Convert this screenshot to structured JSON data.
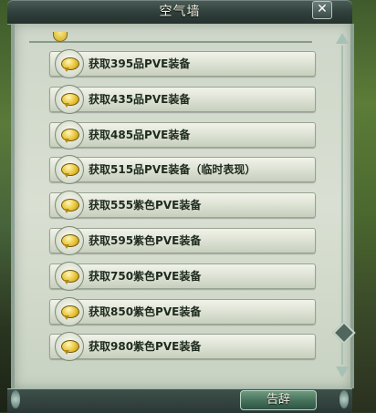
{
  "window": {
    "title": "空气墙",
    "close_glyph": "✕"
  },
  "list": {
    "items": [
      {
        "label": "获取395品PVE装备"
      },
      {
        "label": "获取435品PVE装备"
      },
      {
        "label": "获取485品PVE装备"
      },
      {
        "label": "获取515品PVE装备（临时表现）"
      },
      {
        "label": "获取555紫色PVE装备"
      },
      {
        "label": "获取595紫色PVE装备"
      },
      {
        "label": "获取750紫色PVE装备"
      },
      {
        "label": "获取850紫色PVE装备"
      },
      {
        "label": "获取980紫色PVE装备"
      }
    ]
  },
  "footer": {
    "farewell_label": "告辞"
  },
  "icons": {
    "item_icon": "speech-bubble-icon",
    "close": "close-icon"
  },
  "scrollbar": {
    "position": 0.9
  },
  "colors": {
    "panel_bg": "#d9e0d3",
    "frame": "#8da094",
    "title_bar": "#2f3e3a",
    "button_green": "#44705a",
    "icon_gold": "#e7c02e"
  }
}
